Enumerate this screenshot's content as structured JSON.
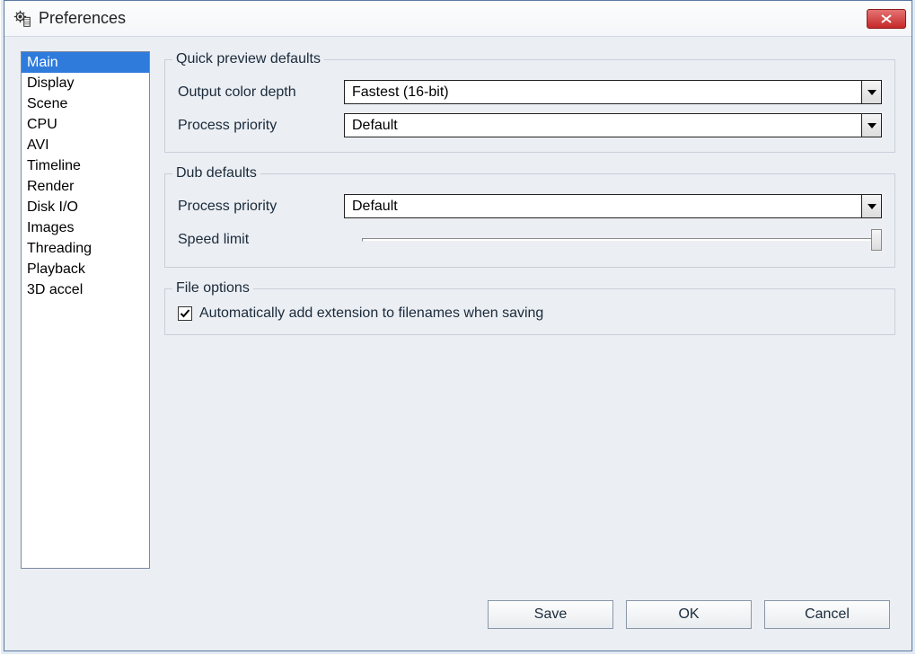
{
  "window": {
    "title": "Preferences"
  },
  "sidebar": {
    "items": [
      {
        "label": "Main",
        "selected": true
      },
      {
        "label": "Display"
      },
      {
        "label": "Scene"
      },
      {
        "label": "CPU"
      },
      {
        "label": "AVI"
      },
      {
        "label": "Timeline"
      },
      {
        "label": "Render"
      },
      {
        "label": "Disk I/O"
      },
      {
        "label": "Images"
      },
      {
        "label": "Threading"
      },
      {
        "label": "Playback"
      },
      {
        "label": "3D accel"
      }
    ]
  },
  "groups": {
    "quick_preview": {
      "legend": "Quick preview defaults",
      "color_depth_label": "Output color depth",
      "color_depth_value": "Fastest (16-bit)",
      "priority_label": "Process priority",
      "priority_value": "Default"
    },
    "dub": {
      "legend": "Dub defaults",
      "priority_label": "Process priority",
      "priority_value": "Default",
      "speed_label": "Speed limit"
    },
    "file": {
      "legend": "File options",
      "auto_ext_label": "Automatically add extension to filenames when saving",
      "auto_ext_checked": true
    }
  },
  "buttons": {
    "save": "Save",
    "ok": "OK",
    "cancel": "Cancel"
  }
}
